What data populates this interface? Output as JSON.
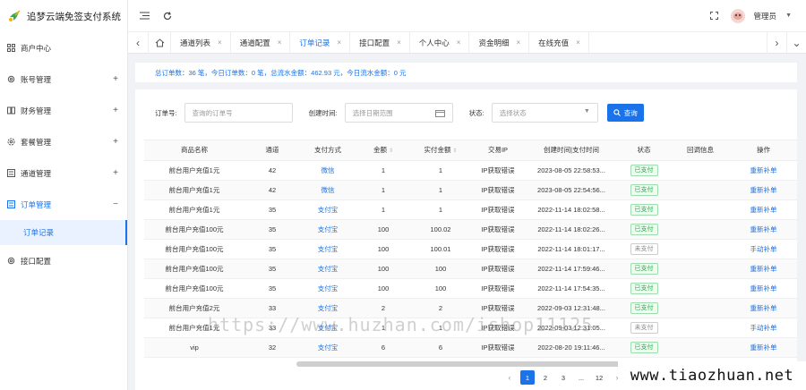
{
  "app": {
    "title": "追梦云端免签支付系统",
    "user": "管理员"
  },
  "sidebar": {
    "items": [
      {
        "label": "商户中心",
        "icon": "grid-icon",
        "toggle": ""
      },
      {
        "label": "账号管理",
        "icon": "gear-icon",
        "toggle": "+"
      },
      {
        "label": "财务管理",
        "icon": "book-icon",
        "toggle": "+"
      },
      {
        "label": "套餐管理",
        "icon": "settings-icon",
        "toggle": "+"
      },
      {
        "label": "通道管理",
        "icon": "list-icon",
        "toggle": "+"
      },
      {
        "label": "订单管理",
        "icon": "list-icon",
        "toggle": "−"
      },
      {
        "label": "接口配置",
        "icon": "gear-icon",
        "toggle": ""
      }
    ],
    "submenu": {
      "label": "订单记录"
    }
  },
  "tabs": [
    {
      "label": "通道列表",
      "close": "×"
    },
    {
      "label": "通道配置",
      "close": "×"
    },
    {
      "label": "订单记录",
      "close": "×"
    },
    {
      "label": "接口配置",
      "close": "×"
    },
    {
      "label": "个人中心",
      "close": "×"
    },
    {
      "label": "资金明细",
      "close": "×"
    },
    {
      "label": "在线充值",
      "close": "×"
    }
  ],
  "summary": {
    "text": "总订单数：36 笔，今日订单数：0 笔，总流水金额：462.93 元，今日流水金额：0 元"
  },
  "filters": {
    "order_label": "订单号:",
    "order_placeholder": "查询的订单号",
    "time_label": "创建时间:",
    "time_placeholder": "选择日期范围",
    "status_label": "状态:",
    "status_placeholder": "选择状态",
    "search_label": "查询"
  },
  "table": {
    "headers": [
      "商品名称",
      "通道",
      "支付方式",
      "金额",
      "实付金额",
      "交易IP",
      "创建时间|支付时间",
      "状态",
      "回调信息",
      "操作"
    ],
    "rows": [
      [
        "前台用户充值1元",
        "42",
        "微信",
        "1",
        "1",
        "IP获取错误",
        "2023-08-05 22:58:53...",
        "已支付",
        "",
        "重新补单"
      ],
      [
        "前台用户充值1元",
        "42",
        "微信",
        "1",
        "1",
        "IP获取错误",
        "2023-08-05 22:54:56...",
        "已支付",
        "",
        "重新补单"
      ],
      [
        "前台用户充值1元",
        "35",
        "支付宝",
        "1",
        "1",
        "IP获取错误",
        "2022-11-14 18:02:58...",
        "已支付",
        "",
        "重新补单"
      ],
      [
        "前台用户充值100元",
        "35",
        "支付宝",
        "100",
        "100.02",
        "IP获取错误",
        "2022-11-14 18:02:26...",
        "已支付",
        "",
        "重新补单"
      ],
      [
        "前台用户充值100元",
        "35",
        "支付宝",
        "100",
        "100.01",
        "IP获取错误",
        "2022-11-14 18:01:17...",
        "未支付",
        "",
        "手动补单"
      ],
      [
        "前台用户充值100元",
        "35",
        "支付宝",
        "100",
        "100",
        "IP获取错误",
        "2022-11-14 17:59:46...",
        "已支付",
        "",
        "重新补单"
      ],
      [
        "前台用户充值100元",
        "35",
        "支付宝",
        "100",
        "100",
        "IP获取错误",
        "2022-11-14 17:54:35...",
        "已支付",
        "",
        "重新补单"
      ],
      [
        "前台用户充值2元",
        "33",
        "支付宝",
        "2",
        "2",
        "IP获取错误",
        "2022-09-03 12:31:48...",
        "已支付",
        "",
        "重新补单"
      ],
      [
        "前台用户充值1元",
        "33",
        "支付宝",
        "1",
        "1",
        "IP获取错误",
        "2022-09-03 12:31:05...",
        "未支付",
        "",
        "手动补单"
      ],
      [
        "vip",
        "32",
        "支付宝",
        "6",
        "6",
        "IP获取错误",
        "2022-08-20 19:11:46...",
        "已支付",
        "",
        "重新补单"
      ]
    ]
  },
  "pagination": {
    "prev": "‹",
    "pages": [
      "1",
      "2",
      "3",
      "...",
      "12"
    ],
    "next": "›",
    "current": "1"
  },
  "watermark": {
    "url": "https://www.huzhan.com/ishop11125",
    "corner": "www.tiaozhuan.net"
  },
  "colors": {
    "accent": "#1a73e8",
    "paid": "#27a844"
  }
}
